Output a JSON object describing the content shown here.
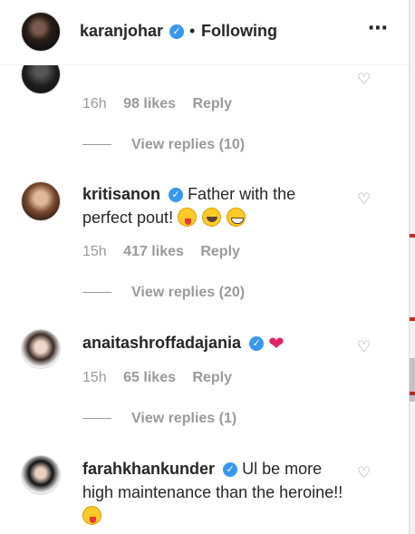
{
  "header": {
    "username": "karanjohar",
    "separator": "•",
    "follow_status": "Following",
    "more_icon": "⋯"
  },
  "comments": [
    {
      "username": "",
      "text": "",
      "time": "16h",
      "likes": "98 likes",
      "reply": "Reply",
      "view_replies": "View replies (10)"
    },
    {
      "username": "kritisanon",
      "text": "Father with the perfect pout!",
      "time": "15h",
      "likes": "417 likes",
      "reply": "Reply",
      "view_replies": "View replies (20)"
    },
    {
      "username": "anaitashroffadajania",
      "text": "",
      "time": "15h",
      "likes": "65 likes",
      "reply": "Reply",
      "view_replies": "View replies (1)"
    },
    {
      "username": "farahkhankunder",
      "text": "Ul be more high maintenance than the heroine!!"
    }
  ],
  "icons": {
    "verified": "verified-badge-icon",
    "like": "heart-outline-icon",
    "more": "more-options-icon"
  },
  "colors": {
    "verified_blue": "#3897f0",
    "meta_gray": "#999999",
    "text_dark": "#262626",
    "heart_red": "#e0245e"
  }
}
